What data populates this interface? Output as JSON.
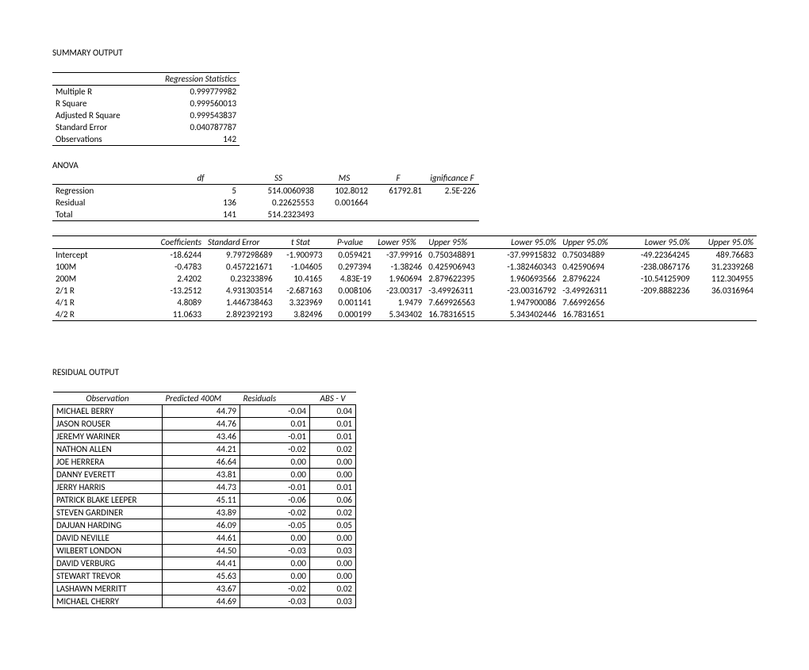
{
  "titles": {
    "summary": "SUMMARY OUTPUT",
    "anova": "ANOVA",
    "residual": "RESIDUAL OUTPUT"
  },
  "regstats": {
    "header": "Regression Statistics",
    "rows": [
      {
        "label": "Multiple R",
        "value": "0.999779982"
      },
      {
        "label": "R Square",
        "value": "0.999560013"
      },
      {
        "label": "Adjusted R Square",
        "value": "0.999543837"
      },
      {
        "label": "Standard Error",
        "value": "0.040787787"
      },
      {
        "label": "Observations",
        "value": "142"
      }
    ]
  },
  "anova": {
    "headers": {
      "df": "df",
      "ss": "SS",
      "ms": "MS",
      "f": "F",
      "sigf": "ignificance F"
    },
    "rows": [
      {
        "label": "Regression",
        "df": "5",
        "ss": "514.0060938",
        "ms": "102.8012",
        "f": "61792.81",
        "sigf": "2.5E-226"
      },
      {
        "label": "Residual",
        "df": "136",
        "ss": "0.22625553",
        "ms": "0.001664",
        "f": "",
        "sigf": ""
      },
      {
        "label": "Total",
        "df": "141",
        "ss": "514.2323493",
        "ms": "",
        "f": "",
        "sigf": ""
      }
    ]
  },
  "coef": {
    "headers": {
      "coef": "Coefficients",
      "se": "Standard Error",
      "t": "t Stat",
      "p": "P-value",
      "l95": "Lower 95%",
      "u95": "Upper 95%",
      "l95b": "Lower 95.0%",
      "u95b": "Upper 95.0%",
      "l95c": "Lower 95.0%",
      "u95c": "Upper 95.0%"
    },
    "rows": [
      {
        "label": "Intercept",
        "coef": "-18.6244",
        "se": "9.797298689",
        "t": "-1.900973",
        "p": "0.059421",
        "l95": "-37.99916",
        "u95": "0.750348891",
        "l95b": "-37.99915832",
        "u95b": "0.75034889",
        "l95c": "-49.22364245",
        "u95c": "489.76683"
      },
      {
        "label": "100M",
        "coef": "-0.4783",
        "se": "0.457221671",
        "t": "-1.04605",
        "p": "0.297394",
        "l95": "-1.38246",
        "u95": "0.425906943",
        "l95b": "-1.382460343",
        "u95b": "0.42590694",
        "l95c": "-238.0867176",
        "u95c": "31.2339268"
      },
      {
        "label": "200M",
        "coef": "2.4202",
        "se": "0.23233896",
        "t": "10.4165",
        "p": "4.83E-19",
        "l95": "1.960694",
        "u95": "2.879622395",
        "l95b": "1.960693566",
        "u95b": "2.8796224",
        "l95c": "-10.54125909",
        "u95c": "112.304955"
      },
      {
        "label": "2/1 R",
        "coef": "-13.2512",
        "se": "4.931303514",
        "t": "-2.687163",
        "p": "0.008106",
        "l95": "-23.00317",
        "u95": "-3.49926311",
        "l95b": "-23.00316792",
        "u95b": "-3.49926311",
        "l95c": "-209.8882236",
        "u95c": "36.0316964"
      },
      {
        "label": "4/1 R",
        "coef": "4.8089",
        "se": "1.446738463",
        "t": "3.323969",
        "p": "0.001141",
        "l95": "1.9479",
        "u95": "7.669926563",
        "l95b": "1.947900086",
        "u95b": "7.66992656",
        "l95c": "",
        "u95c": ""
      },
      {
        "label": "4/2 R",
        "coef": "11.0633",
        "se": "2.892392193",
        "t": "3.82496",
        "p": "0.000199",
        "l95": "5.343402",
        "u95": "16.78316515",
        "l95b": "5.343402446",
        "u95b": "16.7831651",
        "l95c": "",
        "u95c": ""
      }
    ]
  },
  "residuals": {
    "headers": {
      "obs": "Observation",
      "pred": "Predicted 400M",
      "res": "Residuals",
      "absv": "ABS - V"
    },
    "rows": [
      {
        "obs": "MICHAEL BERRY",
        "pred": "44.79",
        "res": "-0.04",
        "absv": "0.04"
      },
      {
        "obs": "JASON ROUSER",
        "pred": "44.76",
        "res": "0.01",
        "absv": "0.01"
      },
      {
        "obs": "JEREMY WARINER",
        "pred": "43.46",
        "res": "-0.01",
        "absv": "0.01"
      },
      {
        "obs": "NATHON ALLEN",
        "pred": "44.21",
        "res": "-0.02",
        "absv": "0.02"
      },
      {
        "obs": "JOE HERRERA",
        "pred": "46.64",
        "res": "0.00",
        "absv": "0.00"
      },
      {
        "obs": "DANNY EVERETT",
        "pred": "43.81",
        "res": "0.00",
        "absv": "0.00"
      },
      {
        "obs": "JERRY HARRIS",
        "pred": "44.73",
        "res": "-0.01",
        "absv": "0.01"
      },
      {
        "obs": "PATRICK BLAKE LEEPER",
        "pred": "45.11",
        "res": "-0.06",
        "absv": "0.06"
      },
      {
        "obs": "STEVEN GARDINER",
        "pred": "43.89",
        "res": "-0.02",
        "absv": "0.02"
      },
      {
        "obs": "DAJUAN HARDING",
        "pred": "46.09",
        "res": "-0.05",
        "absv": "0.05"
      },
      {
        "obs": "DAVID NEVILLE",
        "pred": "44.61",
        "res": "0.00",
        "absv": "0.00"
      },
      {
        "obs": "WILBERT LONDON",
        "pred": "44.50",
        "res": "-0.03",
        "absv": "0.03"
      },
      {
        "obs": "DAVID VERBURG",
        "pred": "44.41",
        "res": "0.00",
        "absv": "0.00"
      },
      {
        "obs": "STEWART TREVOR",
        "pred": "45.63",
        "res": "0.00",
        "absv": "0.00"
      },
      {
        "obs": "LASHAWN MERRITT",
        "pred": "43.67",
        "res": "-0.02",
        "absv": "0.02"
      },
      {
        "obs": "MICHAEL CHERRY",
        "pred": "44.69",
        "res": "-0.03",
        "absv": "0.03"
      }
    ]
  }
}
